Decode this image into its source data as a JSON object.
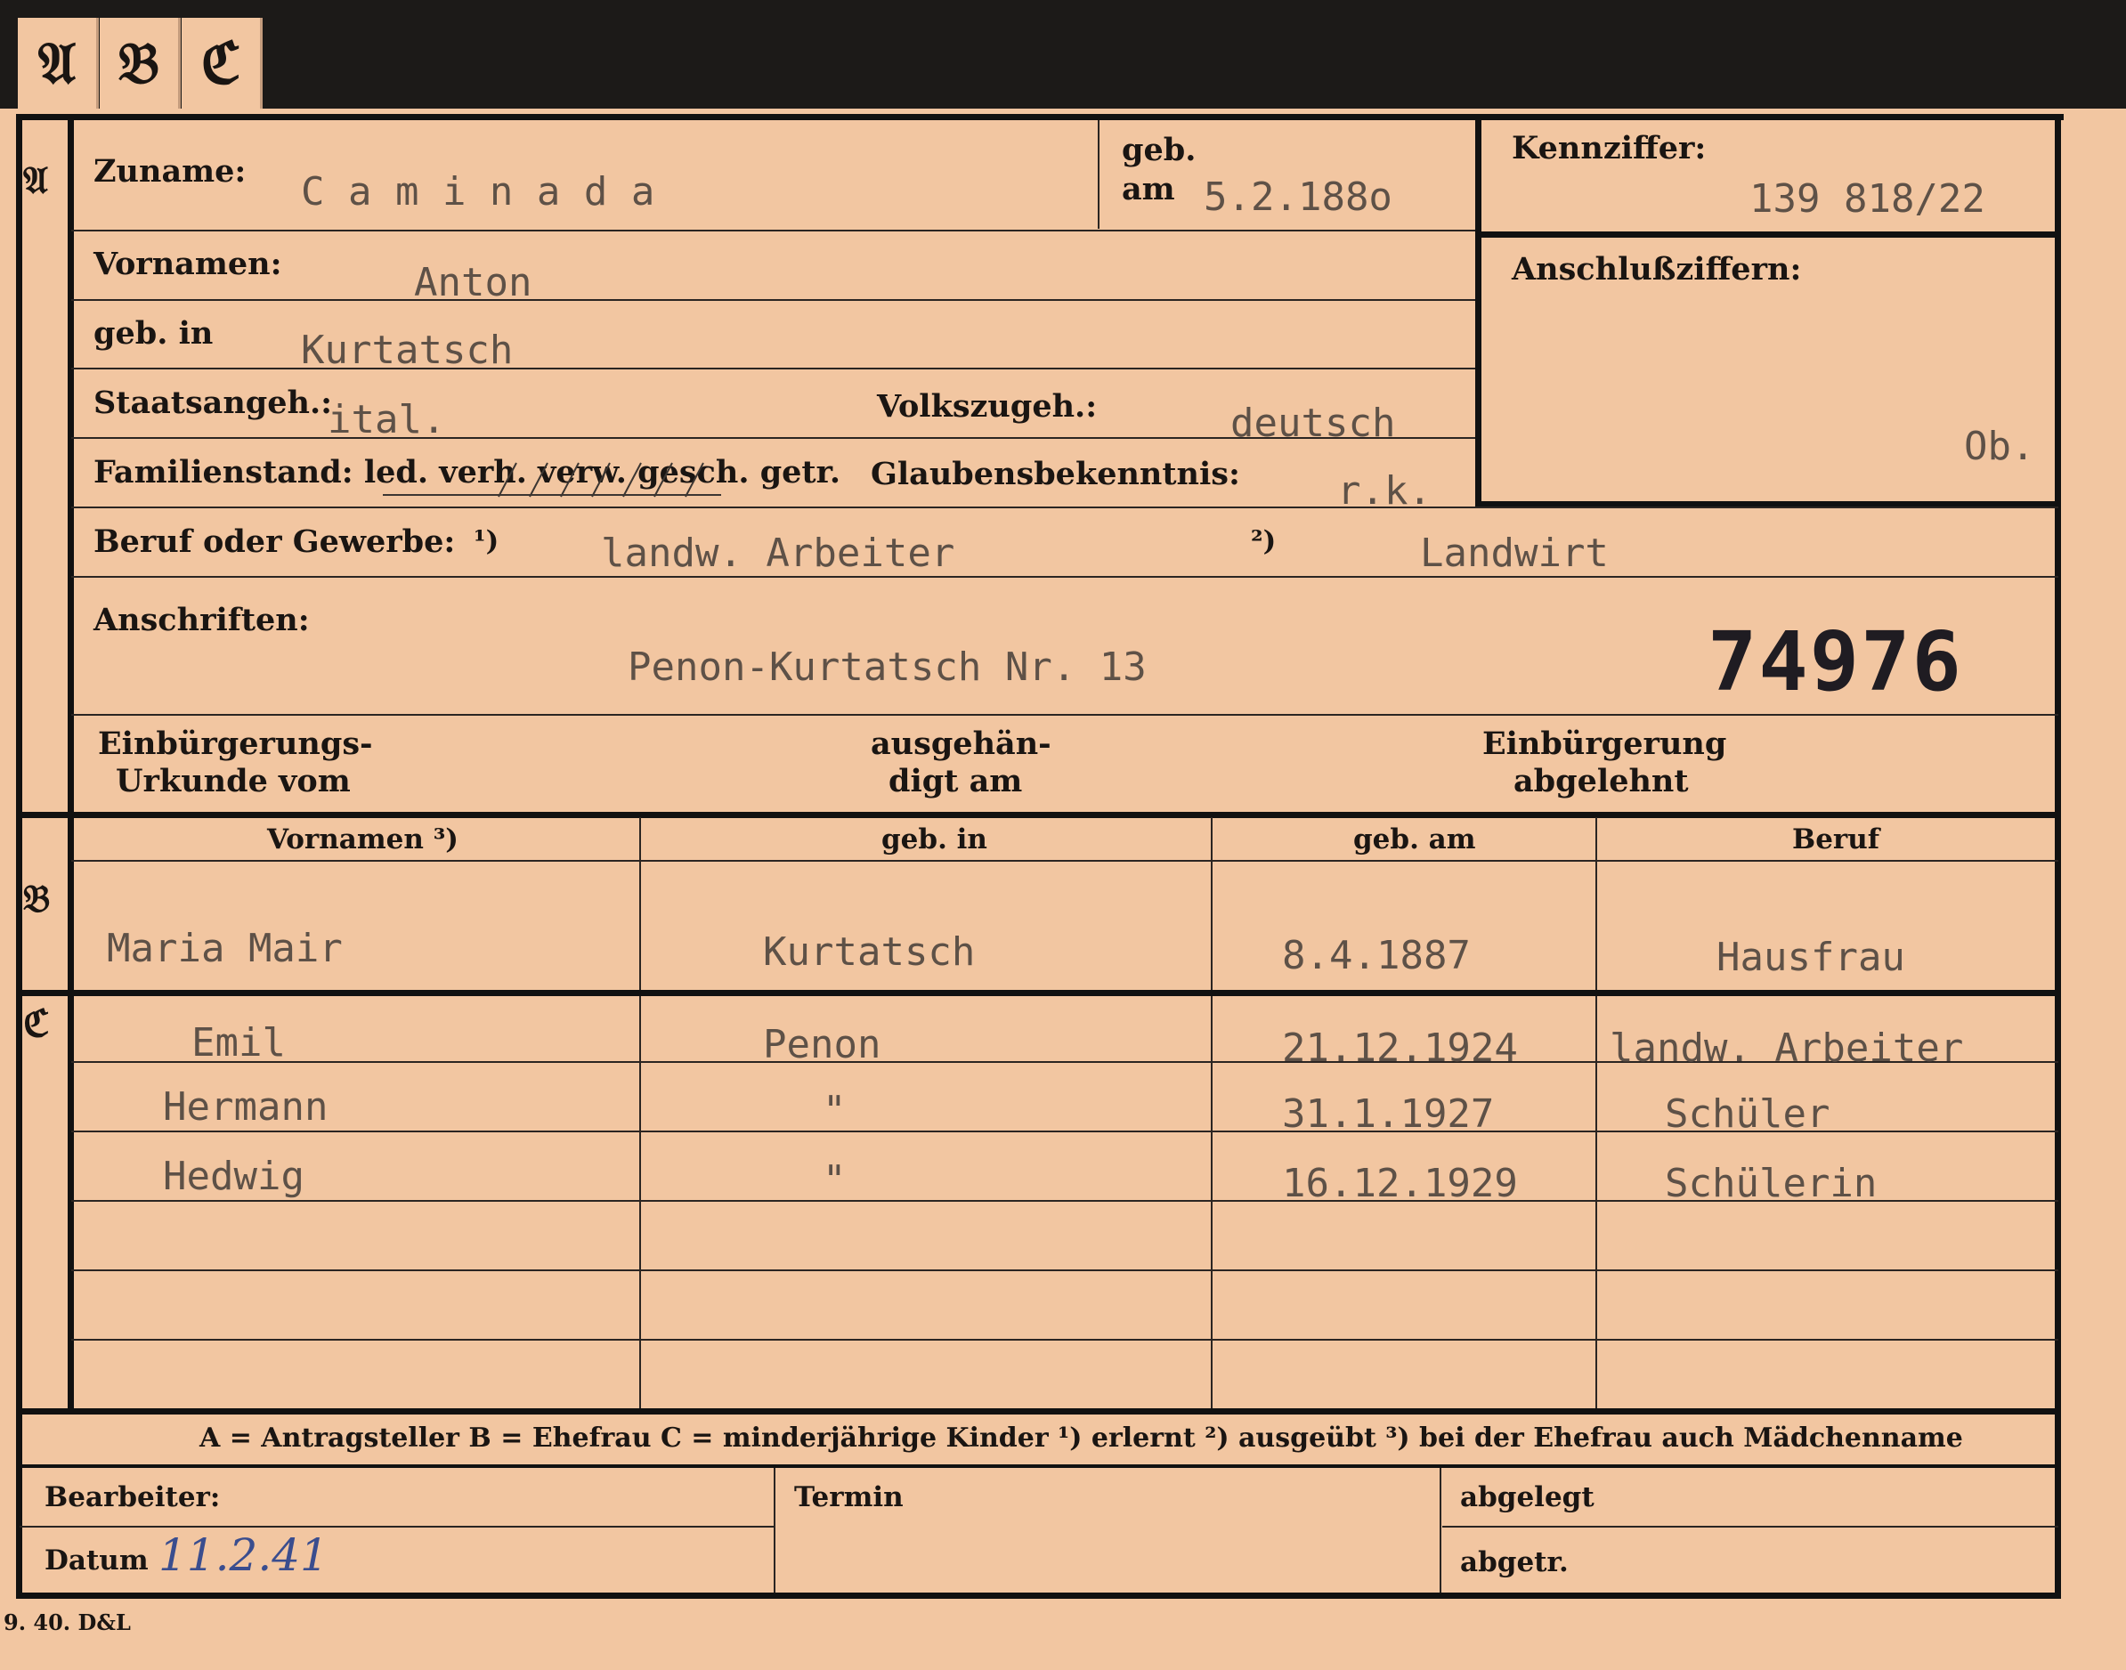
{
  "tabs": [
    "𝔄",
    "𝔅",
    "ℭ"
  ],
  "sections": {
    "a": "𝔄",
    "b": "𝔅",
    "c": "ℭ"
  },
  "labels": {
    "zuname": "Zuname:",
    "geb": "geb.",
    "am": "am",
    "kennziffer": "Kennziffer:",
    "vornamen": "Vornamen:",
    "anschlussziffern": "Anschlußziffern:",
    "geb_in": "geb. in",
    "staatsangeh": "Staatsangeh.:",
    "volkszugeh": "Volkszugeh.:",
    "familienstand": "Familienstand: led. verh. verw. gesch. getr.",
    "glaubensbekenntnis": "Glaubensbekenntnis:",
    "beruf": "Beruf oder Gewerbe:",
    "fn1": "¹)",
    "fn2": "²)",
    "anschriften": "Anschriften:",
    "einb_urk_1": "Einbürgerungs-",
    "einb_urk_2": "Urkunde vom",
    "ausgeh_1": "ausgehän-",
    "ausgeh_2": "digt am",
    "einb_abg_1": "Einbürgerung",
    "einb_abg_2": "abgelehnt",
    "footer_legend": "A = Antragsteller   B = Ehefrau   C = minderjährige Kinder   ¹) erlernt   ²) ausgeübt   ³) bei der Ehefrau auch Mädchenname",
    "bearbeiter": "Bearbeiter:",
    "datum": "Datum",
    "termin": "Termin",
    "abgelegt": "abgelegt",
    "abgetr": "abgetr.",
    "printer_mark": "9. 40. D&L"
  },
  "applicant": {
    "surname": "C a m i n a d a",
    "birth_date": "5.2.188o",
    "kennziffer": "139 818/22",
    "anschluss_note": "Ob.",
    "first_name": "Anton",
    "birth_place": "Kurtatsch",
    "citizenship": "ital.",
    "ethnicity": "deutsch",
    "religion": "r.k.",
    "occupation_learned": "landw. Arbeiter",
    "occupation_practised": "Landwirt",
    "address": "Penon-Kurtatsch Nr. 13",
    "stamp_number": "74976"
  },
  "table_headers": [
    "Vornamen ³)",
    "geb. in",
    "geb. am",
    "Beruf"
  ],
  "wife": {
    "name": "Maria Mair",
    "birth_place": "Kurtatsch",
    "birth_date": "8.4.1887",
    "occupation": "Hausfrau"
  },
  "children": [
    {
      "name": "Emil",
      "birth_place": "Penon",
      "birth_date": "21.12.1924",
      "occupation": "landw. Arbeiter"
    },
    {
      "name": "Hermann",
      "birth_place": "\"",
      "birth_date": "31.1.1927",
      "occupation": "Schüler"
    },
    {
      "name": "Hedwig",
      "birth_place": "\"",
      "birth_date": "16.12.1929",
      "occupation": "Schülerin"
    }
  ],
  "handwritten_date": "11.2.41"
}
